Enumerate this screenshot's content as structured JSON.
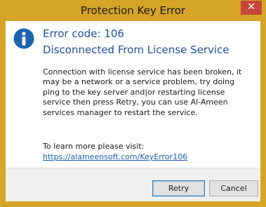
{
  "window": {
    "title": "Protection Key Error",
    "close_glyph": "✕",
    "frame_color": "#d6a427",
    "close_color": "#c7453a"
  },
  "error": {
    "icon": "info-icon",
    "icon_color": "#1e62b0",
    "code": "Error code: 106",
    "title": "Disconnected From License Service",
    "heading_color": "#1f4fa0",
    "message": "Connection with license service has been broken, it may be a network or a service problem, try doing ping to the key server and|or restarting license service then press Retry, you can use Al-Ameen services manager to restart the service.",
    "learn_more_label": "To learn more please visit:",
    "link": "https://alameensoft.com/KeyError106",
    "link_color": "#1a5fb4"
  },
  "buttons": {
    "retry": "Retry",
    "cancel": "Cancel"
  }
}
